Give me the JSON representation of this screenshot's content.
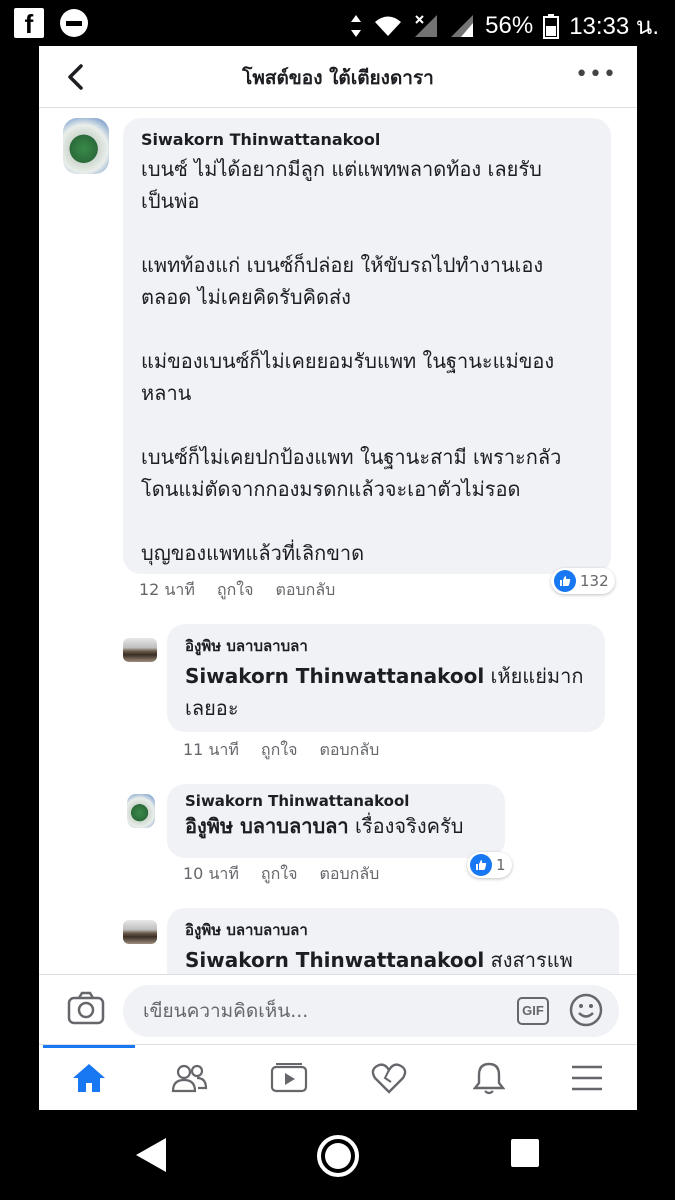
{
  "status_bar": {
    "fb_icon": "f",
    "battery": "56%",
    "time": "13:33 น."
  },
  "header": {
    "title": "โพสต์ของ ใต้เตียงดารา",
    "more": "•••"
  },
  "comments": [
    {
      "author": "Siwakorn Thinwattanakool",
      "text": "เบนซ์ ไม่ได้อยากมีลูก แต่แพทพลาดท้อง เลยรับ\nเป็นพ่อ\n\nแพทท้องแก่ เบนซ์ก็ปล่อย ให้ขับรถไปทำงานเอง\nตลอด ไม่เคยคิดรับคิดส่ง\n\nแม่ของเบนซ์ก็ไม่เคยยอมรับแพท ในฐานะแม่ของ\nหลาน\n\nเบนซ์ก็ไม่เคยปกป้องแพท ในฐานะสามี เพราะกลัว\nโดนแม่ตัดจากกองมรดกแล้วจะเอาตัวไม่รอด\n\nบุญของแพทแล้วที่เลิกขาด",
      "time": "12 นาที",
      "like": "ถูกใจ",
      "reply": "ตอบกลับ",
      "reactions": "132"
    },
    {
      "author": "อิงูพิษ บลาบลาบลา",
      "mention": "Siwakorn Thinwattanakool",
      "text": " เห้ยแย่มาก\nเลยอะ",
      "time": "11 นาที",
      "like": "ถูกใจ",
      "reply": "ตอบกลับ"
    },
    {
      "author": "Siwakorn Thinwattanakool",
      "mention": "อิงูพิษ บลาบลาบลา",
      "text": " เรื่องจริงครับ",
      "time": "10 นาที",
      "like": "ถูกใจ",
      "reply": "ตอบกลับ",
      "reactions": "1"
    },
    {
      "author": "อิงูพิษ บลาบลาบลา",
      "mention": "Siwakorn Thinwattanakool",
      "text": " สงสารแพ"
    }
  ],
  "composer": {
    "placeholder": "เขียนความคิดเห็น...",
    "gif_label": "GIF"
  },
  "colors": {
    "accent": "#1877f2",
    "bubble": "#f0f2f5",
    "meta": "#65676b"
  },
  "nav_icons": [
    "home-icon",
    "friends-icon",
    "watch-icon",
    "dating-icon",
    "notifications-icon",
    "menu-icon"
  ]
}
